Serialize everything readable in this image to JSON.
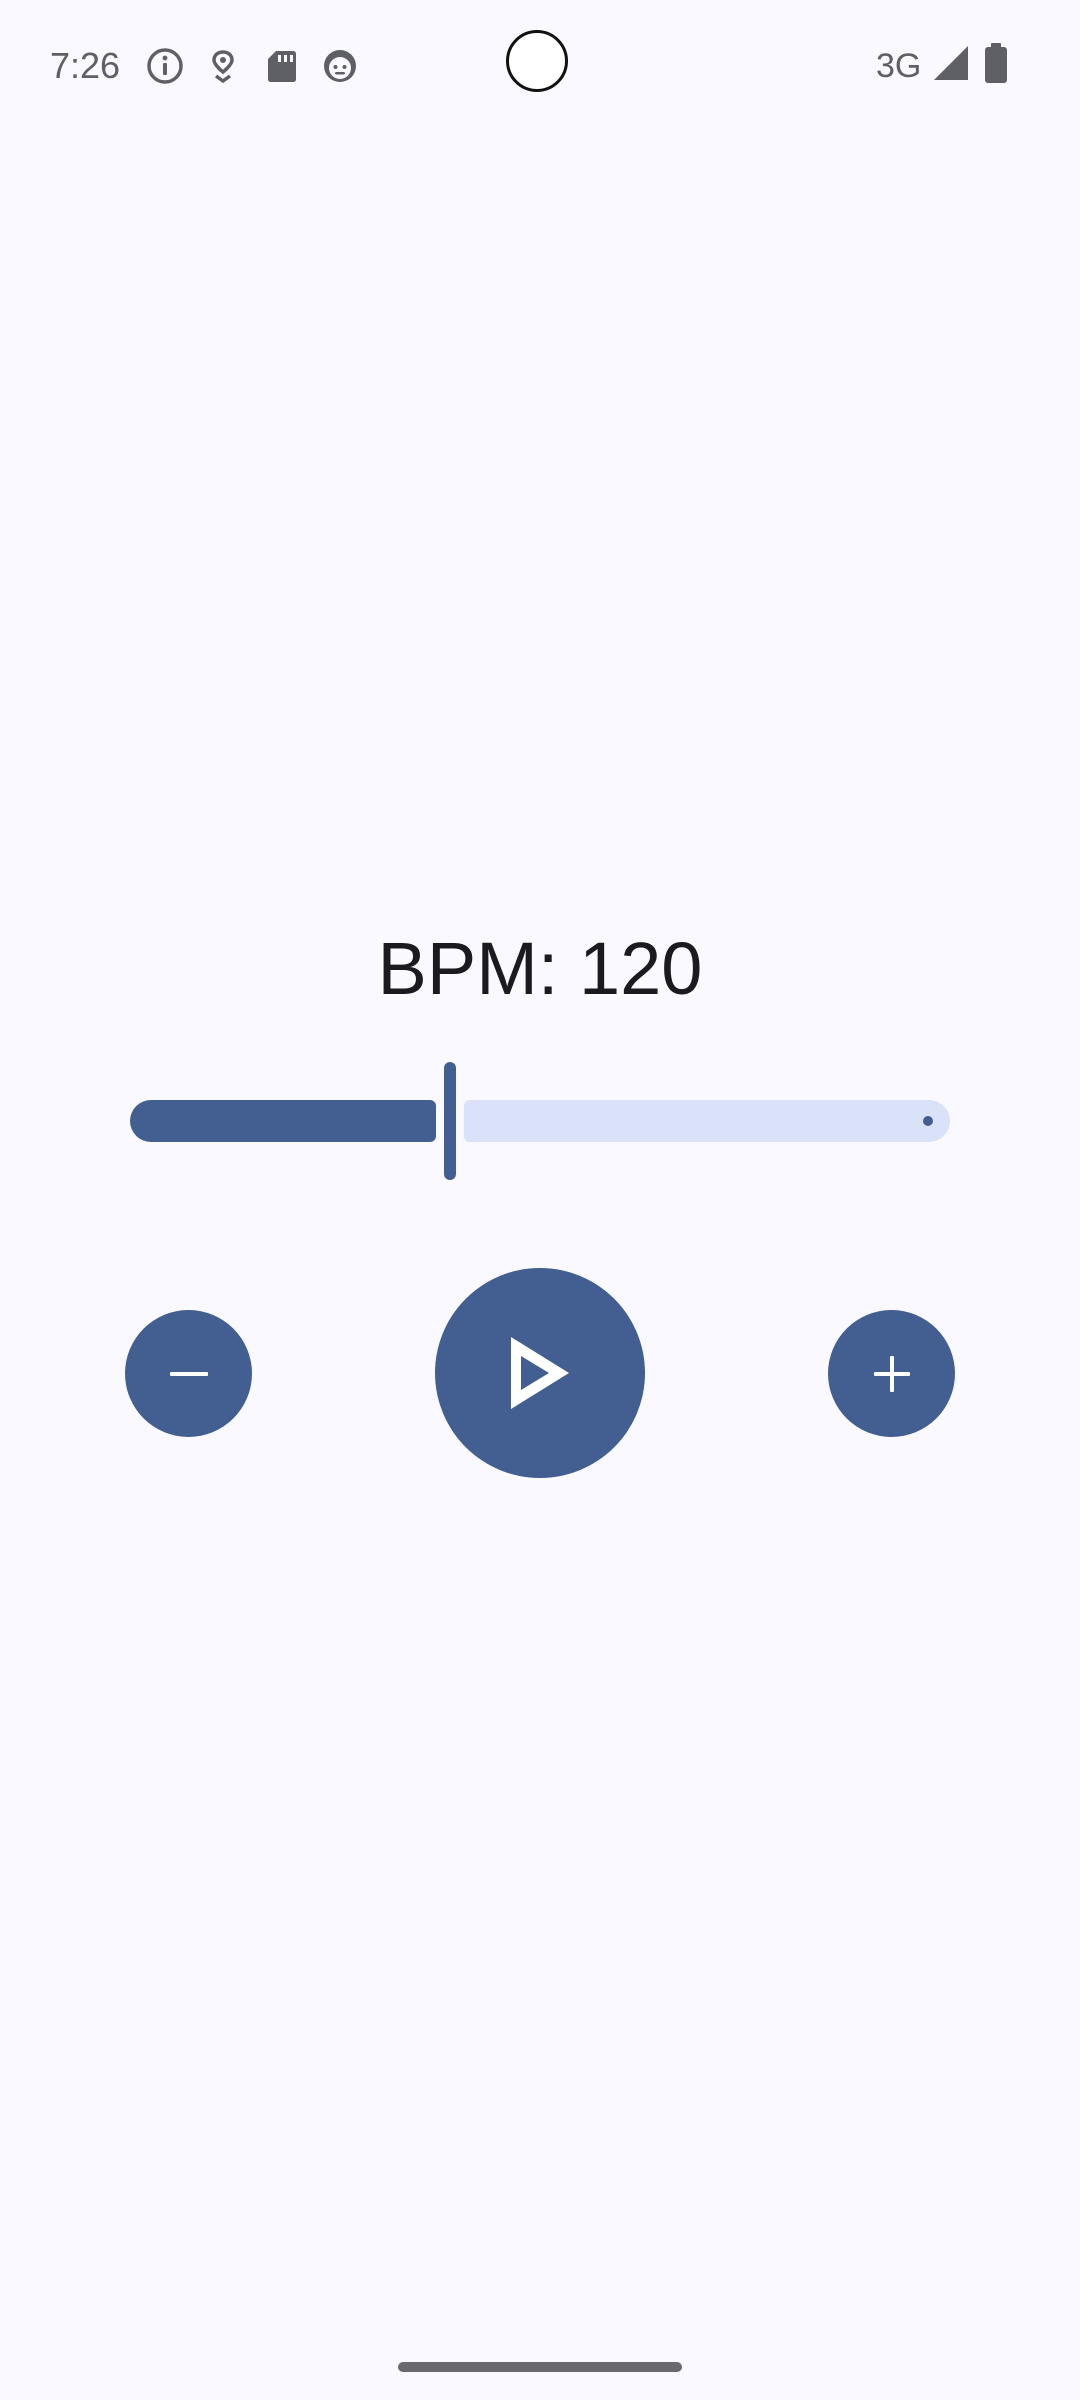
{
  "status_bar": {
    "time": "7:26",
    "network": "3G",
    "icons": [
      "info-icon",
      "location-pin-icon",
      "sd-card-icon",
      "face-icon",
      "signal-icon",
      "battery-icon"
    ]
  },
  "metronome": {
    "bpm_text": "BPM: 120",
    "slider": {
      "value_fraction": 0.39
    },
    "buttons": {
      "decrease_icon": "minus-icon",
      "play_icon": "play-icon",
      "increase_icon": "plus-icon"
    }
  },
  "colors": {
    "background": "#f9f9ff",
    "primary": "#435e91",
    "track_inactive": "#dae2f9",
    "text": "#1b1b1f",
    "status_icons": "#5f6065"
  }
}
